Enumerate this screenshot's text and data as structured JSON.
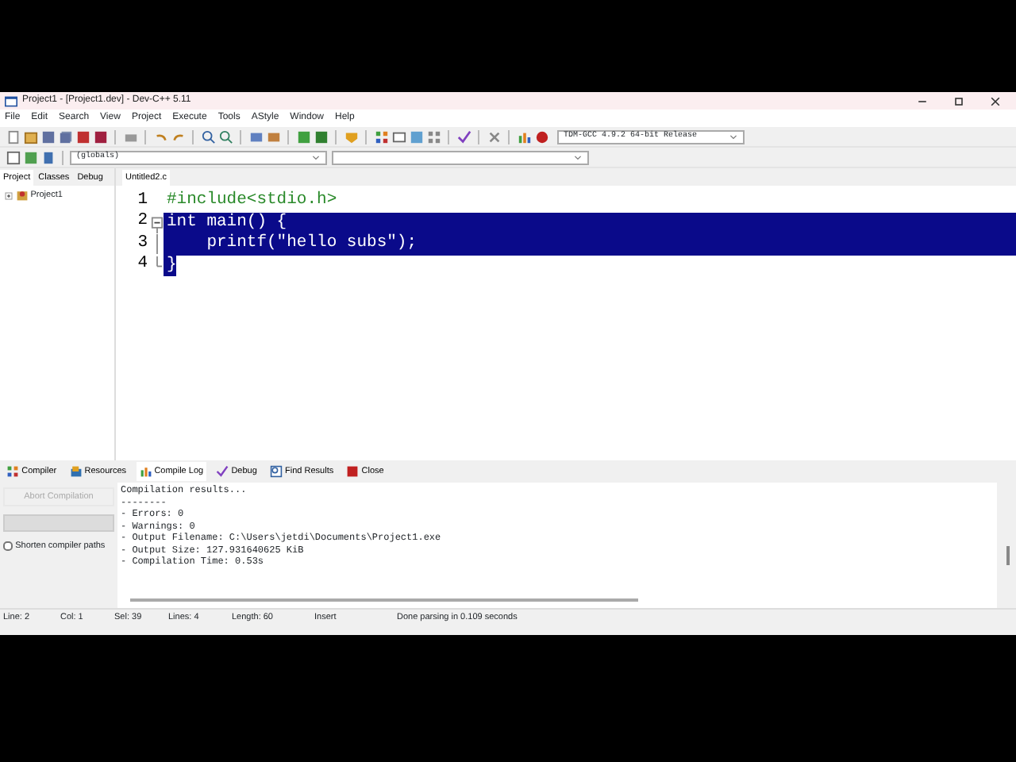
{
  "window": {
    "title": "Project1 - [Project1.dev] - Dev-C++ 5.11"
  },
  "menu": [
    "File",
    "Edit",
    "Search",
    "View",
    "Project",
    "Execute",
    "Tools",
    "AStyle",
    "Window",
    "Help"
  ],
  "compiler_select": {
    "value": "TDM-GCC 4.9.2 64-bit Release"
  },
  "scope_select": {
    "value": "(globals)"
  },
  "left_tabs": [
    {
      "label": "Project",
      "selected": true
    },
    {
      "label": "Classes",
      "selected": false
    },
    {
      "label": "Debug",
      "selected": false
    }
  ],
  "project_tree": [
    {
      "label": "Project1",
      "expanded": false
    }
  ],
  "editor_tabs": [
    {
      "label": "Untitled2.c",
      "selected": true
    }
  ],
  "code_lines": [
    {
      "number": "1",
      "text": "#include<stdio.h>",
      "kind": "preprocessor",
      "selected": false,
      "fold_start": false
    },
    {
      "number": "2",
      "text": "int main() {",
      "kind": "code",
      "selected": true,
      "fold_start": true
    },
    {
      "number": "3",
      "text": "    printf(\"hello subs\");",
      "kind": "code",
      "selected": true,
      "fold_start": false
    },
    {
      "number": "4",
      "text": "}",
      "kind": "code",
      "selected": true,
      "fold_start": false
    }
  ],
  "bottom_tabs": [
    {
      "label": "Compiler",
      "selected": false
    },
    {
      "label": "Resources",
      "selected": false
    },
    {
      "label": "Compile Log",
      "selected": true
    },
    {
      "label": "Debug",
      "selected": false
    },
    {
      "label": "Find Results",
      "selected": false
    },
    {
      "label": "Close",
      "selected": false
    }
  ],
  "abort_button": {
    "label": "Abort Compilation",
    "disabled": true
  },
  "compile_progress": {
    "level": 0
  },
  "shorten_paths": {
    "label": "Shorten compiler paths",
    "checked": false
  },
  "compile_log": [
    "Compilation results...",
    "--------",
    "- Errors: 0",
    "- Warnings: 0",
    "- Output Filename: C:\\Users\\jetdi\\Documents\\Project1.exe",
    "- Output Size: 127.931640625 KiB",
    "- Compilation Time: 0.53s"
  ],
  "status_bar": [
    {
      "label": "Line:",
      "value": "2"
    },
    {
      "label": "Col:",
      "value": "1"
    },
    {
      "label": "Sel:",
      "value": "39"
    },
    {
      "label": "Lines:",
      "value": "4"
    },
    {
      "label": "Length:",
      "value": "60"
    },
    {
      "value": "Insert"
    },
    {
      "value": "Done parsing in 0.109 seconds"
    }
  ]
}
